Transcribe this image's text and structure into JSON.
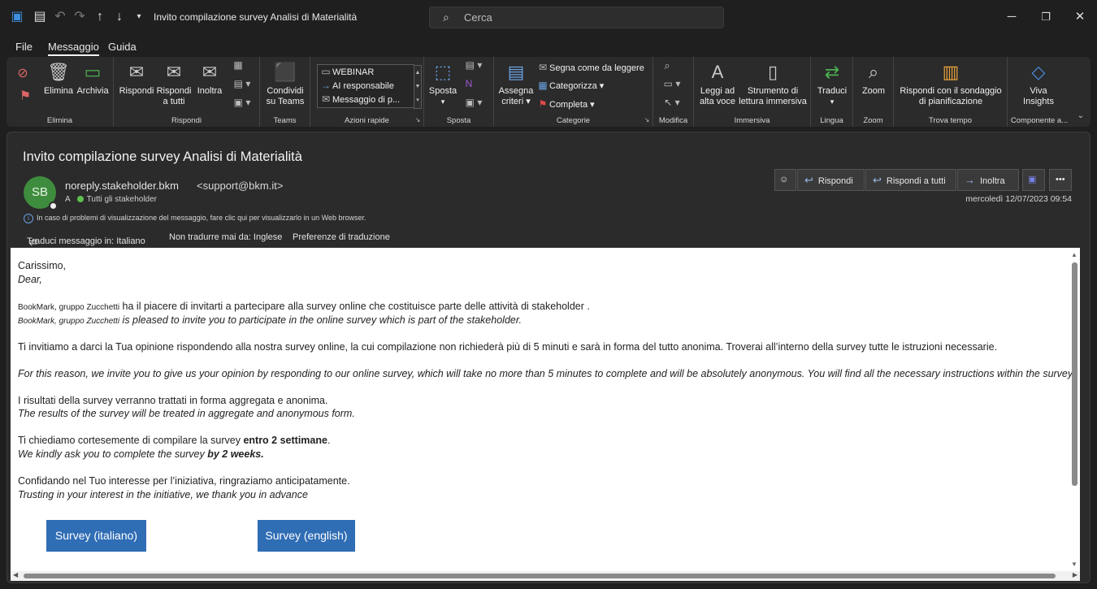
{
  "window": {
    "title": "Invito compilazione survey Analisi di Materialità",
    "search_placeholder": "Cerca"
  },
  "menu": [
    "File",
    "Messaggio",
    "Guida"
  ],
  "ribbon": {
    "groups": {
      "elimina": "Elimina",
      "rispondi": "Rispondi",
      "teams": "Teams",
      "azioni_rapide": "Azioni rapide",
      "sposta": "Sposta",
      "categorie": "Categorie",
      "modifica": "Modifica",
      "immersiva": "Immersiva",
      "lingua": "Lingua",
      "zoom": "Zoom",
      "trova_tempo": "Trova tempo",
      "componente": "Componente a..."
    },
    "buttons": {
      "elimina": "Elimina",
      "archivia": "Archivia",
      "rispondi": "Rispondi",
      "rispondi_tutti_1": "Rispondi",
      "rispondi_tutti_2": "a tutti",
      "inoltra": "Inoltra",
      "condividi_1": "Condividi",
      "condividi_2": "su Teams",
      "sposta": "Sposta",
      "assegna_1": "Assegna",
      "assegna_2": "criteri",
      "segna": "Segna come da leggere",
      "categorizza": "Categorizza",
      "completa": "Completa",
      "leggi_1": "Leggi ad",
      "leggi_2": "alta voce",
      "strumento_1": "Strumento di",
      "strumento_2": "lettura immersiva",
      "traduci": "Traduci",
      "zoom": "Zoom",
      "sondaggio_1": "Rispondi con il sondaggio",
      "sondaggio_2": "di pianificazione",
      "viva_1": "Viva",
      "viva_2": "Insights"
    },
    "quick_steps": [
      "WEBINAR",
      "AI responsabile",
      "Messaggio di p..."
    ]
  },
  "message": {
    "subject": "Invito compilazione survey Analisi di Materialità",
    "avatar_initials": "SB",
    "sender_name": "noreply.stakeholder.bkm",
    "sender_address": "<support@bkm.it>",
    "to_prefix": "A",
    "to": "Tutti gli stakeholder",
    "info": "In caso di problemi di visualizzazione del messaggio, fare clic qui per visualizzarlo in un Web browser.",
    "translate": [
      "Traduci messaggio in: Italiano",
      "Non tradurre mai da: Inglese",
      "Preferenze di traduzione"
    ],
    "actions": [
      "Rispondi",
      "Rispondi a tutti",
      "Inoltra"
    ],
    "date": "mercoledì 12/07/2023 09:54"
  },
  "body": {
    "greeting_it": "Carissimo,",
    "greeting_en": "Dear,",
    "company": "BookMark, gruppo Zucchetti",
    "intro_it": " ha il piacere di invitarti a partecipare alla survey online che costituisce parte delle attività di stakeholder .",
    "intro_en": " is pleased to invite you to participate in the online survey which is part of the stakeholder.",
    "p1_it": "Ti invitiamo a darci la Tua opinione rispondendo alla nostra survey online, la cui compilazione non richiederà più di 5 minuti e sarà in forma del tutto anonima. Troverai all’interno della survey tutte le istruzioni necessarie.",
    "p1_en": "For this reason, we invite you to give us your opinion by responding to our online survey, which will take no more than 5 minutes to complete and will be absolutely anonymous. You will find all the necessary instructions within the survey.",
    "p2_it": "I risultati della survey verranno trattati in forma aggregata e anonima.",
    "p2_en": "The results of the survey will be treated in aggregate and anonymous form.",
    "p3_it_pre": "Ti chiediamo cortesemente di compilare la survey ",
    "p3_it_bold": "entro 2 settimane",
    "p3_it_post": ".",
    "p3_en_pre": "We kindly ask you to complete the survey ",
    "p3_en_bold": "by 2 weeks.",
    "p4_it": "Confidando nel Tuo interesse per l’iniziativa, ringraziamo anticipatamente.",
    "p4_en": "Trusting in your interest in the initiative, we thank you in advance",
    "btn_it": "Survey (italiano)",
    "btn_en": "Survey (english)"
  }
}
